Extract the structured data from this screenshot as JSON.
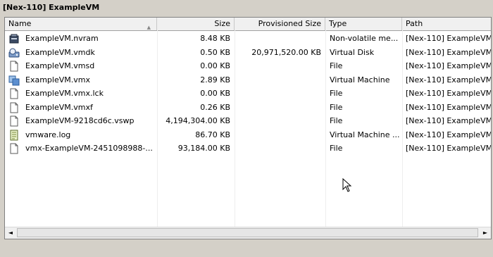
{
  "title": "[Nex-110] ExampleVM",
  "columns": {
    "name": "Name",
    "size": "Size",
    "provisioned": "Provisioned Size",
    "type": "Type",
    "path": "Path"
  },
  "files": [
    {
      "icon": "nvram-icon",
      "name": "ExampleVM.nvram",
      "size": "8.48 KB",
      "provisioned": "",
      "type": "Non-volatile me...",
      "path": "[Nex-110] ExampleVM"
    },
    {
      "icon": "virtual-disk-icon",
      "name": "ExampleVM.vmdk",
      "size": "0.50 KB",
      "provisioned": "20,971,520.00 KB",
      "type": "Virtual Disk",
      "path": "[Nex-110] ExampleVM"
    },
    {
      "icon": "file-icon",
      "name": "ExampleVM.vmsd",
      "size": "0.00 KB",
      "provisioned": "",
      "type": "File",
      "path": "[Nex-110] ExampleVM"
    },
    {
      "icon": "virtual-machine-icon",
      "name": "ExampleVM.vmx",
      "size": "2.89 KB",
      "provisioned": "",
      "type": "Virtual Machine",
      "path": "[Nex-110] ExampleVM"
    },
    {
      "icon": "file-icon",
      "name": "ExampleVM.vmx.lck",
      "size": "0.00 KB",
      "provisioned": "",
      "type": "File",
      "path": "[Nex-110] ExampleVM"
    },
    {
      "icon": "file-icon",
      "name": "ExampleVM.vmxf",
      "size": "0.26 KB",
      "provisioned": "",
      "type": "File",
      "path": "[Nex-110] ExampleVM"
    },
    {
      "icon": "file-icon",
      "name": "ExampleVM-9218cd6c.vswp",
      "size": "4,194,304.00 KB",
      "provisioned": "",
      "type": "File",
      "path": "[Nex-110] ExampleVM"
    },
    {
      "icon": "log-file-icon",
      "name": "vmware.log",
      "size": "86.70 KB",
      "provisioned": "",
      "type": "Virtual Machine ...",
      "path": "[Nex-110] ExampleVM"
    },
    {
      "icon": "file-icon",
      "name": "vmx-ExampleVM-2451098988-...",
      "size": "93,184.00 KB",
      "provisioned": "",
      "type": "File",
      "path": "[Nex-110] ExampleVM"
    }
  ],
  "scroll": {
    "left_arrow": "◄",
    "right_arrow": "►"
  },
  "sort_indicator": "▲"
}
